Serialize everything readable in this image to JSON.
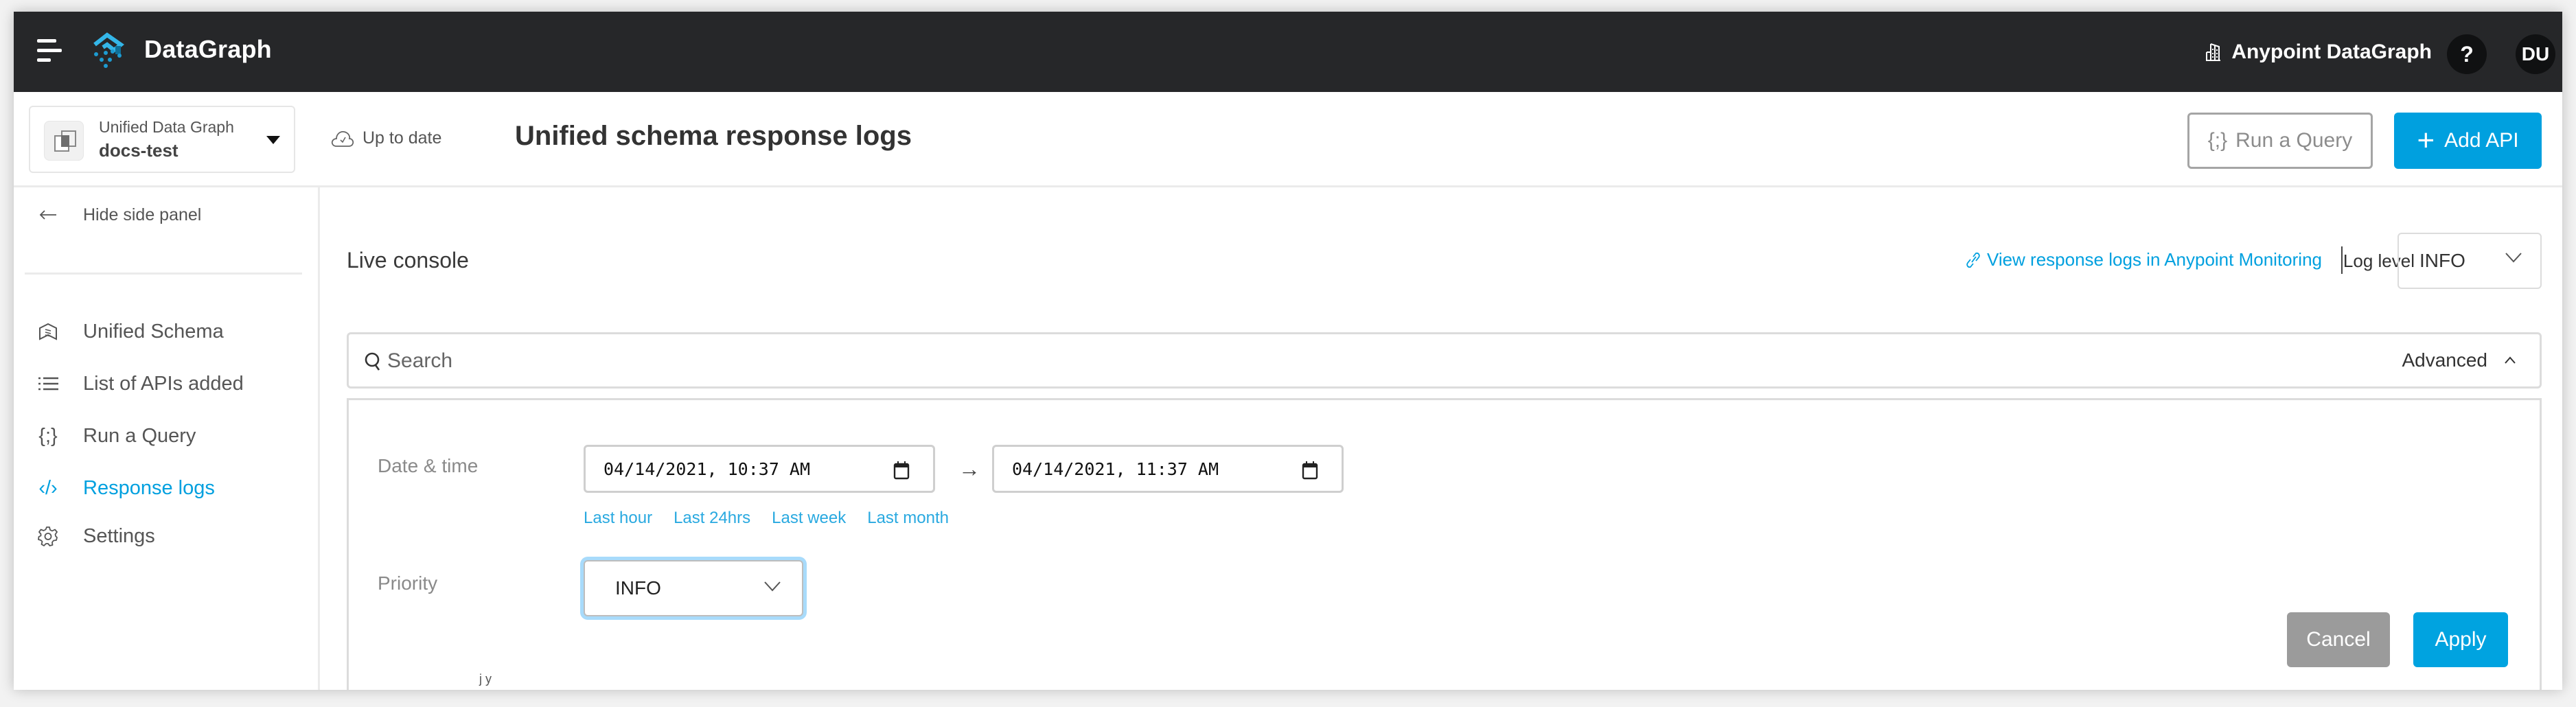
{
  "topbar": {
    "brand": "DataGraph",
    "org_name": "Anypoint DataGraph",
    "help_label": "?",
    "avatar_initials": "DU",
    "icons": {
      "menu": "hamburger-icon",
      "logo": "datagraph-logo-icon",
      "org": "building-icon"
    }
  },
  "header": {
    "graph_selector": {
      "subtitle": "Unified Data Graph",
      "name": "docs-test"
    },
    "status": "Up to date",
    "title": "Unified schema response logs",
    "run_query_label": "Run a Query",
    "run_query_icon_text": "{;}",
    "add_api_label": "Add API",
    "add_api_icon_text": "+"
  },
  "sidebar": {
    "hide_label": "Hide side panel",
    "items": [
      {
        "label": "Unified Schema",
        "icon": "schema-icon",
        "active": false
      },
      {
        "label": "List of APIs added",
        "icon": "list-icon",
        "active": false
      },
      {
        "label": "Run a Query",
        "icon": "braces-icon",
        "icon_text": "{;}",
        "active": false
      },
      {
        "label": "Response logs",
        "icon": "code-icon",
        "icon_text": "‹/›",
        "active": true
      },
      {
        "label": "Settings",
        "icon": "gear-icon",
        "active": false
      }
    ]
  },
  "main": {
    "section_title": "Live console",
    "monitoring_link": "View response logs in Anypoint Monitoring",
    "log_level_label": "Log level",
    "log_level_value": "INFO",
    "search": {
      "placeholder": "Search",
      "value": ""
    },
    "advanced_label": "Advanced",
    "advanced_panel": {
      "date_label": "Date & time",
      "date_from": "04/14/2021, 10:37 AM",
      "date_to": "04/14/2021, 11:37 AM",
      "range_arrow": "→",
      "quick_ranges": [
        "Last hour",
        "Last 24hrs",
        "Last week",
        "Last month"
      ],
      "priority_label": "Priority",
      "priority_value": "INFO",
      "cancel_label": "Cancel",
      "apply_label": "Apply"
    },
    "truncated_text": "j y"
  },
  "colors": {
    "accent": "#00a0df",
    "topbar_bg": "#262729",
    "cancel_bg": "#9b9b9b",
    "focus_ring": "#a8dbfb"
  }
}
